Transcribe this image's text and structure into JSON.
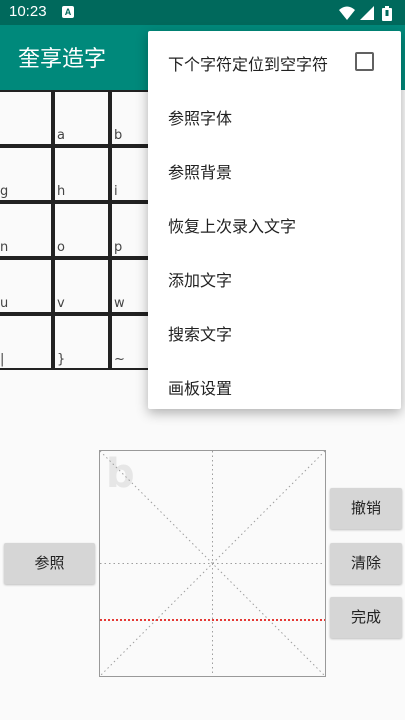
{
  "status_bar": {
    "time": "10:23",
    "notification_badge": "A",
    "icons": [
      "wifi-icon",
      "signal-icon",
      "battery-icon"
    ]
  },
  "app_bar": {
    "title": "奎享造字"
  },
  "grid": {
    "columns": 7,
    "cells": [
      "",
      "a",
      "b",
      "",
      "",
      "",
      "",
      "g",
      "h",
      "i",
      "",
      "",
      "",
      "",
      "n",
      "o",
      "p",
      "",
      "",
      "",
      "",
      "u",
      "v",
      "w",
      "",
      "",
      "",
      "",
      "|",
      "}",
      "~",
      "",
      "",
      "",
      ""
    ]
  },
  "drawing_pad": {
    "reference_char": "b"
  },
  "buttons": {
    "reference": "参照",
    "undo": "撤销",
    "clear": "清除",
    "done": "完成"
  },
  "menu": {
    "items": [
      {
        "label": "下个字符定位到空字符",
        "checkbox": true,
        "checked": false
      },
      {
        "label": "参照字体"
      },
      {
        "label": "参照背景"
      },
      {
        "label": "恢复上次录入文字"
      },
      {
        "label": "添加文字"
      },
      {
        "label": "搜索文字"
      },
      {
        "label": "画板设置"
      }
    ]
  },
  "colors": {
    "status_bar": "#00695c",
    "app_bar": "#00897b",
    "guide_line_red": "#e53935"
  }
}
